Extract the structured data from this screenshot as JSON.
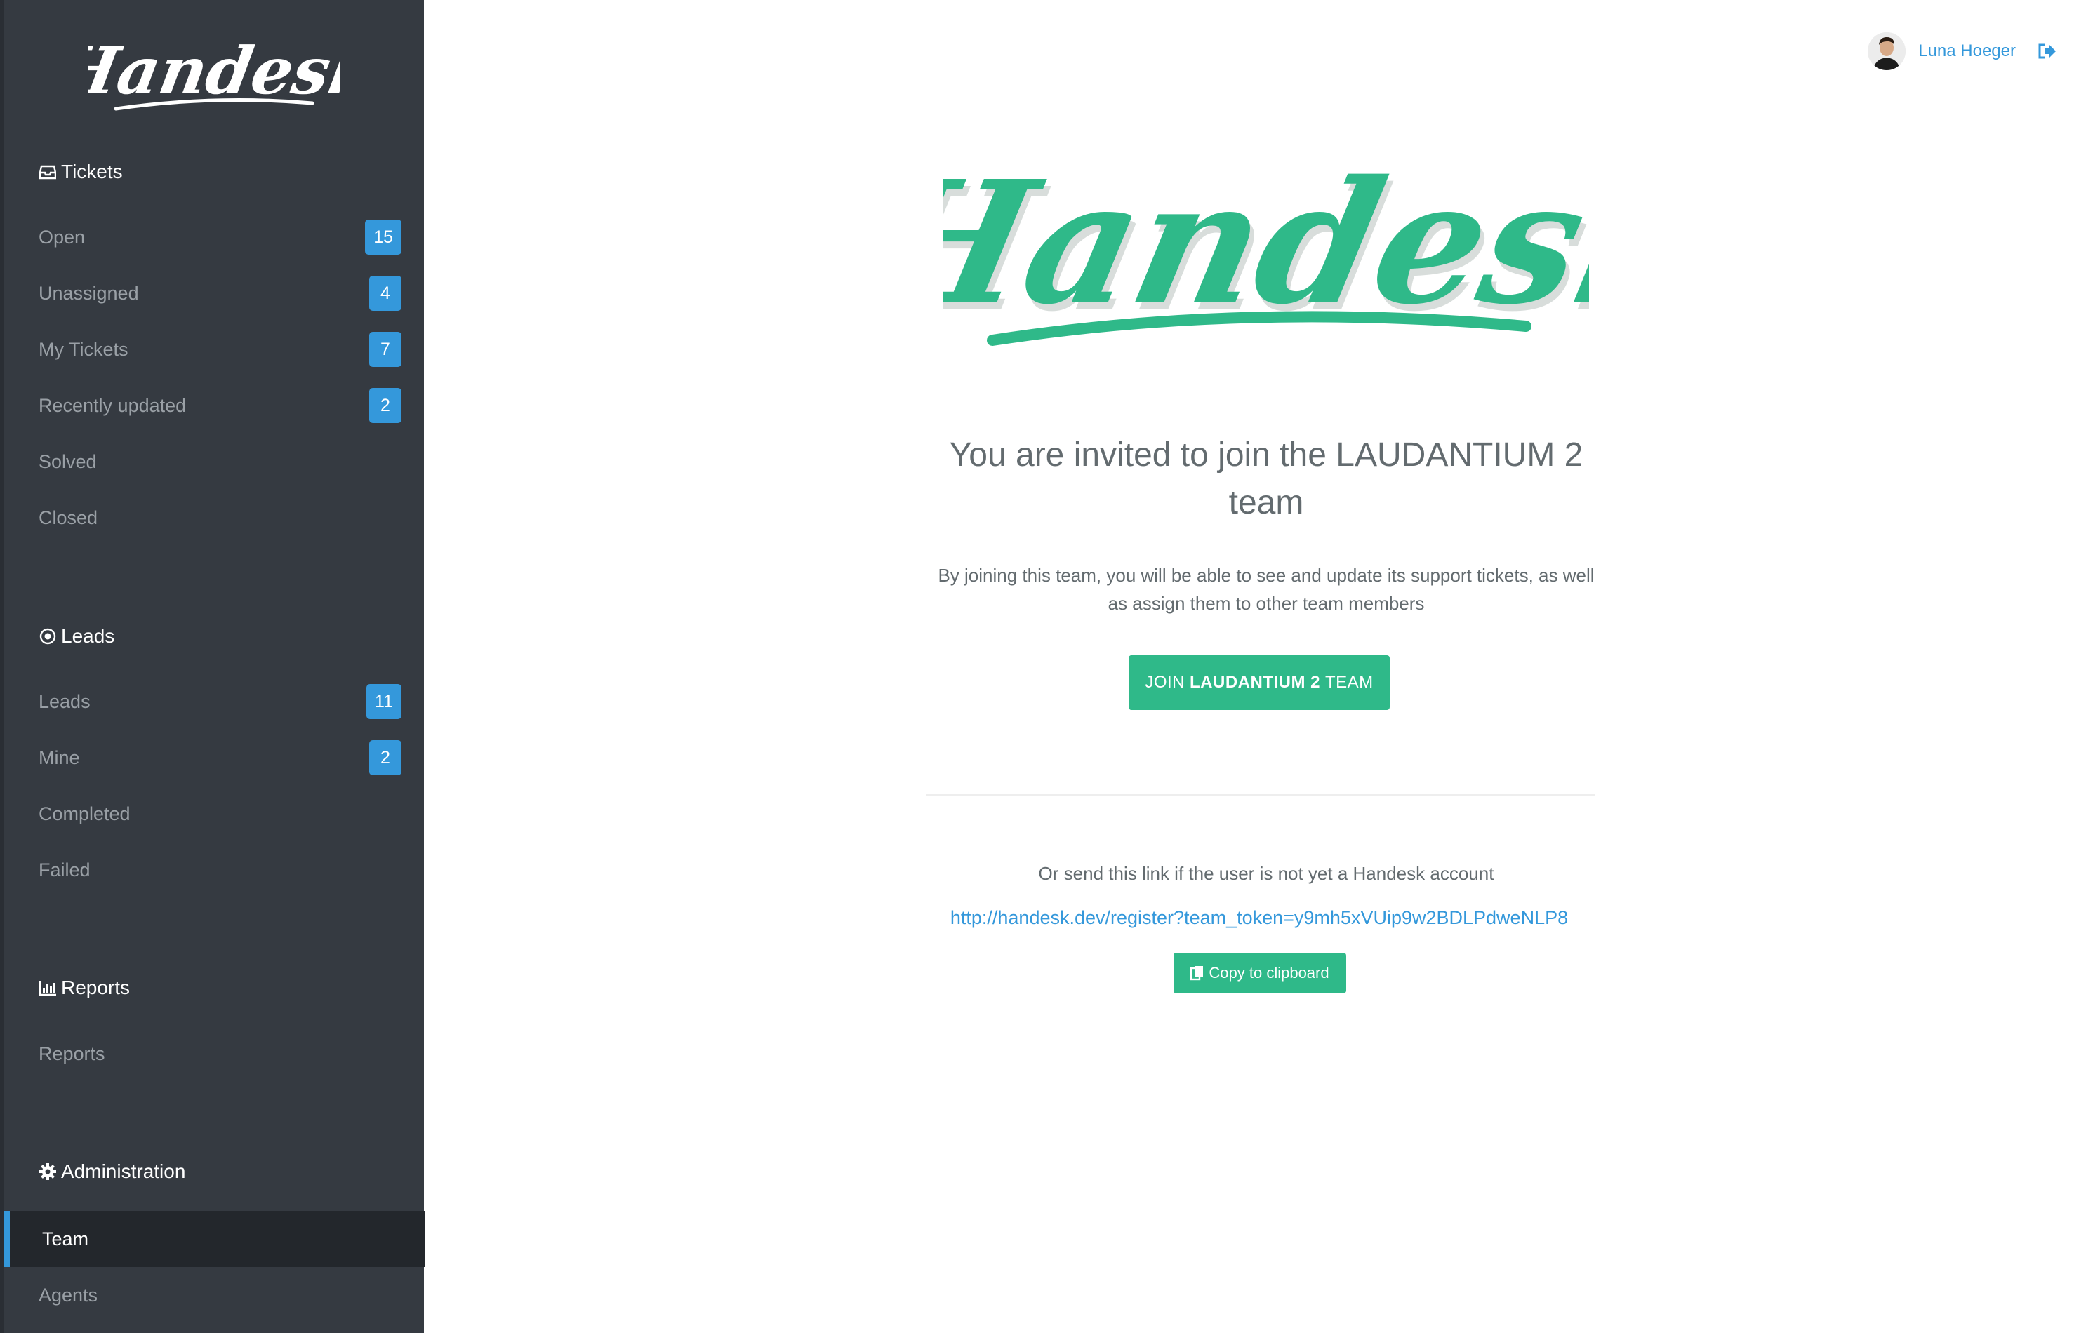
{
  "app": {
    "logo_text": "Handesk",
    "accent_color": "#2fb989",
    "link_color": "#3498db",
    "sidebar_bg": "#353a41"
  },
  "sidebar": {
    "tickets": {
      "title": "Tickets",
      "icon": "inbox-icon",
      "items": [
        {
          "label": "Open",
          "badge": "15"
        },
        {
          "label": "Unassigned",
          "badge": "4"
        },
        {
          "label": "My Tickets",
          "badge": "7"
        },
        {
          "label": "Recently updated",
          "badge": "2"
        },
        {
          "label": "Solved"
        },
        {
          "label": "Closed"
        }
      ]
    },
    "leads": {
      "title": "Leads",
      "icon": "target-icon",
      "items": [
        {
          "label": "Leads",
          "badge": "11"
        },
        {
          "label": "Mine",
          "badge": "2"
        },
        {
          "label": "Completed"
        },
        {
          "label": "Failed"
        }
      ]
    },
    "reports": {
      "title": "Reports",
      "icon": "bar-chart-icon",
      "items": [
        {
          "label": "Reports"
        }
      ]
    },
    "administration": {
      "title": "Administration",
      "icon": "gear-icon",
      "items": [
        {
          "label": "Team",
          "active": true
        },
        {
          "label": "Agents"
        }
      ]
    }
  },
  "header": {
    "user_name": "Luna Hoeger",
    "logout_icon": "sign-out-icon"
  },
  "main": {
    "logo_text": "Handesk",
    "invite_title_line1": "You are invited to join the LAUDANTIUM 2",
    "invite_title_line2": "team",
    "description_line1": "By joining this team, you will be able to see and update its support tickets, as well",
    "description_line2": "as assign them to other team members",
    "join_button": {
      "prefix": "JOIN",
      "team": "LAUDANTIUM 2",
      "suffix": "TEAM"
    },
    "send_link_text": "Or send this link if the user is not yet a Handesk account",
    "register_link": "http://handesk.dev/register?team_token=y9mh5xVUip9w2BDLPdweNLP8",
    "copy_button_label": "Copy to clipboard",
    "copy_icon": "clipboard-icon"
  }
}
